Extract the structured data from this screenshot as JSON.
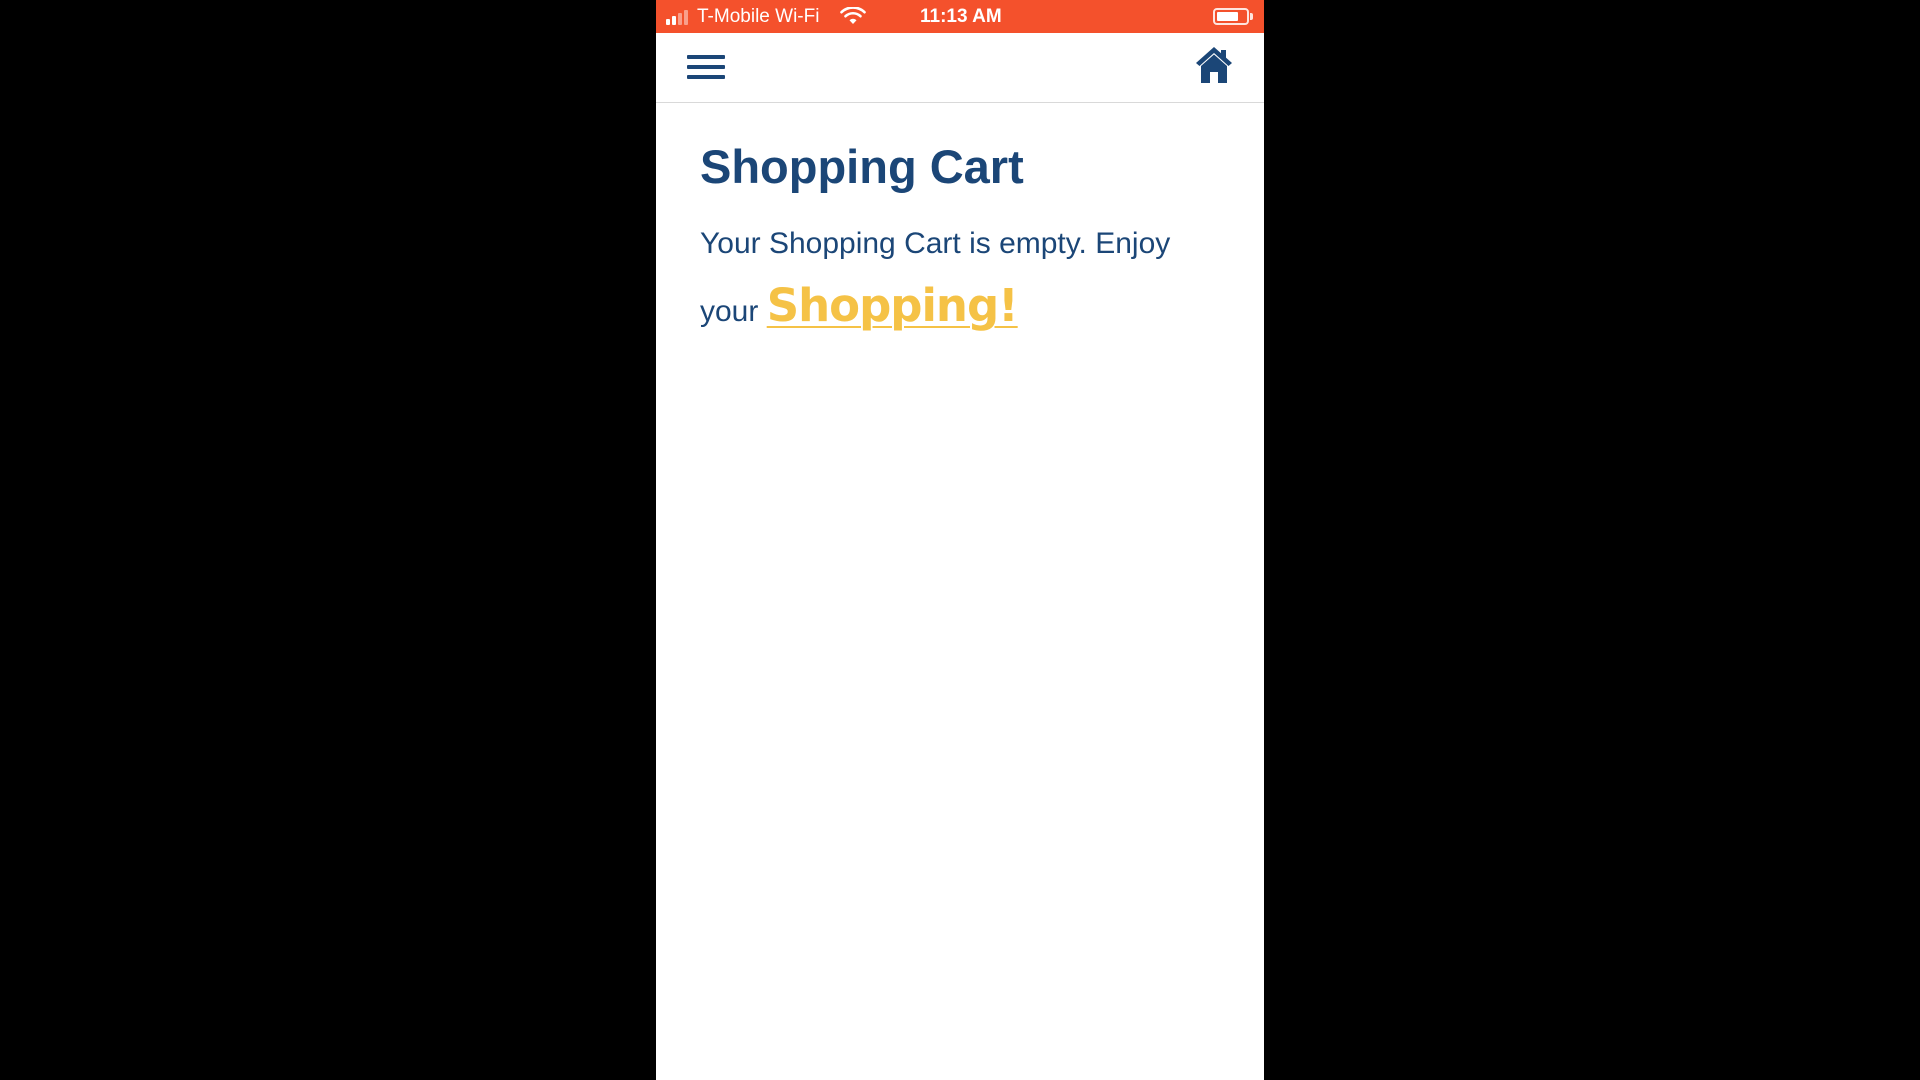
{
  "status_bar": {
    "carrier": "T-Mobile Wi-Fi",
    "time": "11:13 AM",
    "background_color": "#f4512c",
    "signal_bars": 2,
    "signal_bars_total": 4,
    "battery_level": 0.75
  },
  "nav": {
    "menu_icon": "hamburger-menu-icon",
    "home_icon": "home-icon",
    "icon_color": "#1b4677"
  },
  "main": {
    "title": "Shopping Cart",
    "message_text": "Your Shopping Cart is empty. Enjoy your ",
    "link_label": "Shopping!",
    "text_color": "#1b4677",
    "link_color": "#f5c246"
  }
}
